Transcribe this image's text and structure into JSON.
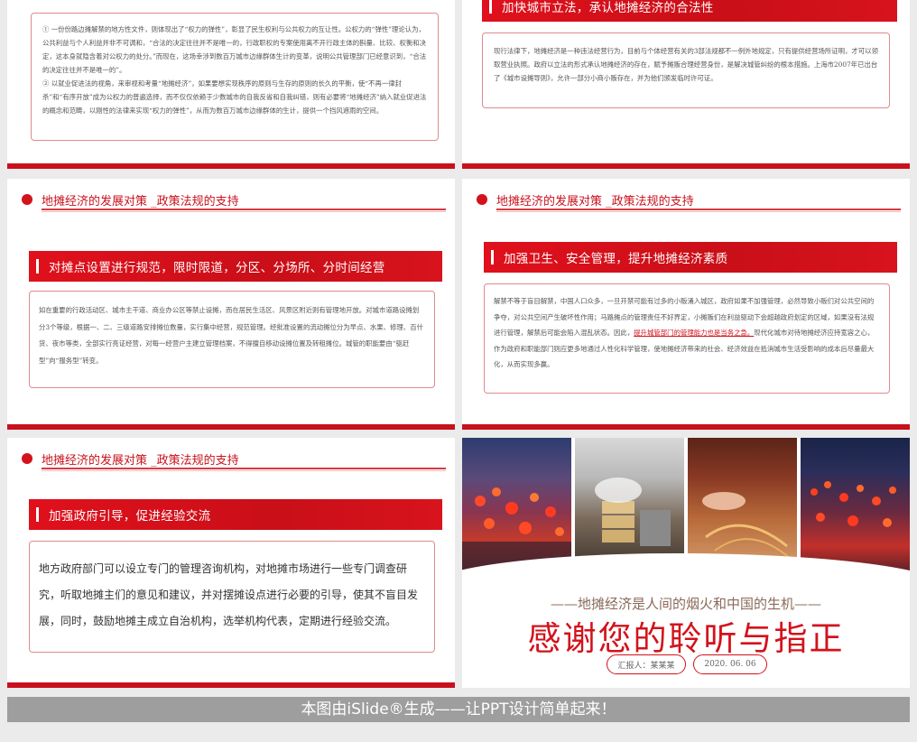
{
  "slide1": {
    "paragraphs": [
      "① 一份份路边摊解禁的地方性文件，则体现出了“权力的弹性”，彰显了民生权利与公共权力的互让性。公权力的“弹性”理论认为，公共利益与个人利益并非不可调和，“合法的决定往往并不是唯一的，行政职权的专案使用离不开行政主体的斟量、比较、权衡和决定，这本身就隐含着对公权力的处分。”而现在，这场幸涉到数百万城市边缘群体生计的变革，说明公共管理部门已经意识到，“合法的决定往往并不是唯一的”。",
      "② 以就业促进法的视角，来审视和考量“地摊经济”，如果要想实现秩序的原则与生存的原则的长久的平衡，使“不再一律封杀”和“有序开放”成为公权力的普遍选择，而不仅仅依赖于少数城市的自我反省和自我纠错，则有必要将“地摊经济”纳入就业促进法的概念和范畴，以刚性的法律来实现“权力的弹性”，从而为数百万城市边缘群体的生计，提供一个挡风遮雨的空间。"
    ]
  },
  "slide2": {
    "bar_title": "加快城市立法，承认地摊经济的合法性",
    "body": "现行法律下，地摊经济是一种违法经营行为，目前与个体经营有关的3部法规都不一例外地规定，只有提供经营场所证明，才可以领取营业执照。政府以立法的形式承认地摊经济的存在，赋予摊贩合理经营身份，是解决城管纠纷的根本措施。上海市2007年已出台了《城市设摊导则》，允许一部分小商小贩存在，并为他们颁发临时许可证。"
  },
  "slide3": {
    "header": "地摊经济的发展对策 _政策法规的支持",
    "bar_title": "对摊点设置进行规范，限时限道，分区、分场所、分时间经营",
    "body": "如在重要的行政活动区、城市主干道、商业办公区等禁止设摊，而在居民生活区、风景区附近则有管理地开放。对城市道路设摊划分3个等级，根据一、二、三级道路安排摊位数量，实行集中经营，规范管理。经批准设置的流动摊位分为早点、水果、修理、百什货、夜市等类，全部实行亮证经营，对每一经营户主建立管理档案，不得擅自移动设摊位置及转租摊位。城管的职能要由“驱赶型”向“服务型”转变。"
  },
  "slide4": {
    "header": "地摊经济的发展对策 _政策法规的支持",
    "bar_title": "加强卫生、安全管理，提升地摊经济素质",
    "body_before": "解禁不等于盲目解禁，中国人口众多，一旦开禁可能有过多的小贩涌入城区，政府如果不加强管理，必然导致小贩们对公共空间的争夺，对公共空间产生破坏性作用；马路摊点的管理责任不好界定，小摊贩们在利益驱动下会超越政府划定的区域，如果没有法规进行管理，解禁后可能会陷入混乱状态。因此，",
    "body_highlight": "提升城管部门的管理能力也是当务之急。",
    "body_after": "现代化城市对待地摊经济应持宽容之心，作为政府和职能部门则应更多地通过人性化科学管理，使地摊经济带来的社会、经济效益在抵消城市生活受影响的成本后尽量最大化，从而实现多赢。"
  },
  "slide5": {
    "header": "地摊经济的发展对策 _政策法规的支持",
    "bar_title": "加强政府引导，促进经验交流",
    "body": "地方政府部门可以设立专门的管理咨询机构，对地摊市场进行一些专门调查研究，听取地摊主们的意见和建议，并对摆摊设点进行必要的引导，使其不盲目发展，同时，鼓励地摊主成立自治机构，选举机构代表，定期进行经验交流。"
  },
  "slide6": {
    "subtitle": "——地摊经济是人间的烟火和中国的生机——",
    "title": "感谢您的聆听与指正",
    "reporter": "汇报人：某某某",
    "date": "2020. 06. 06"
  },
  "footer": {
    "text": "本图由iSlide®生成——让PPT设计简单起来！"
  },
  "colors": {
    "brand_red": "#c8111c",
    "footer_gray": "#9e9e9e"
  }
}
